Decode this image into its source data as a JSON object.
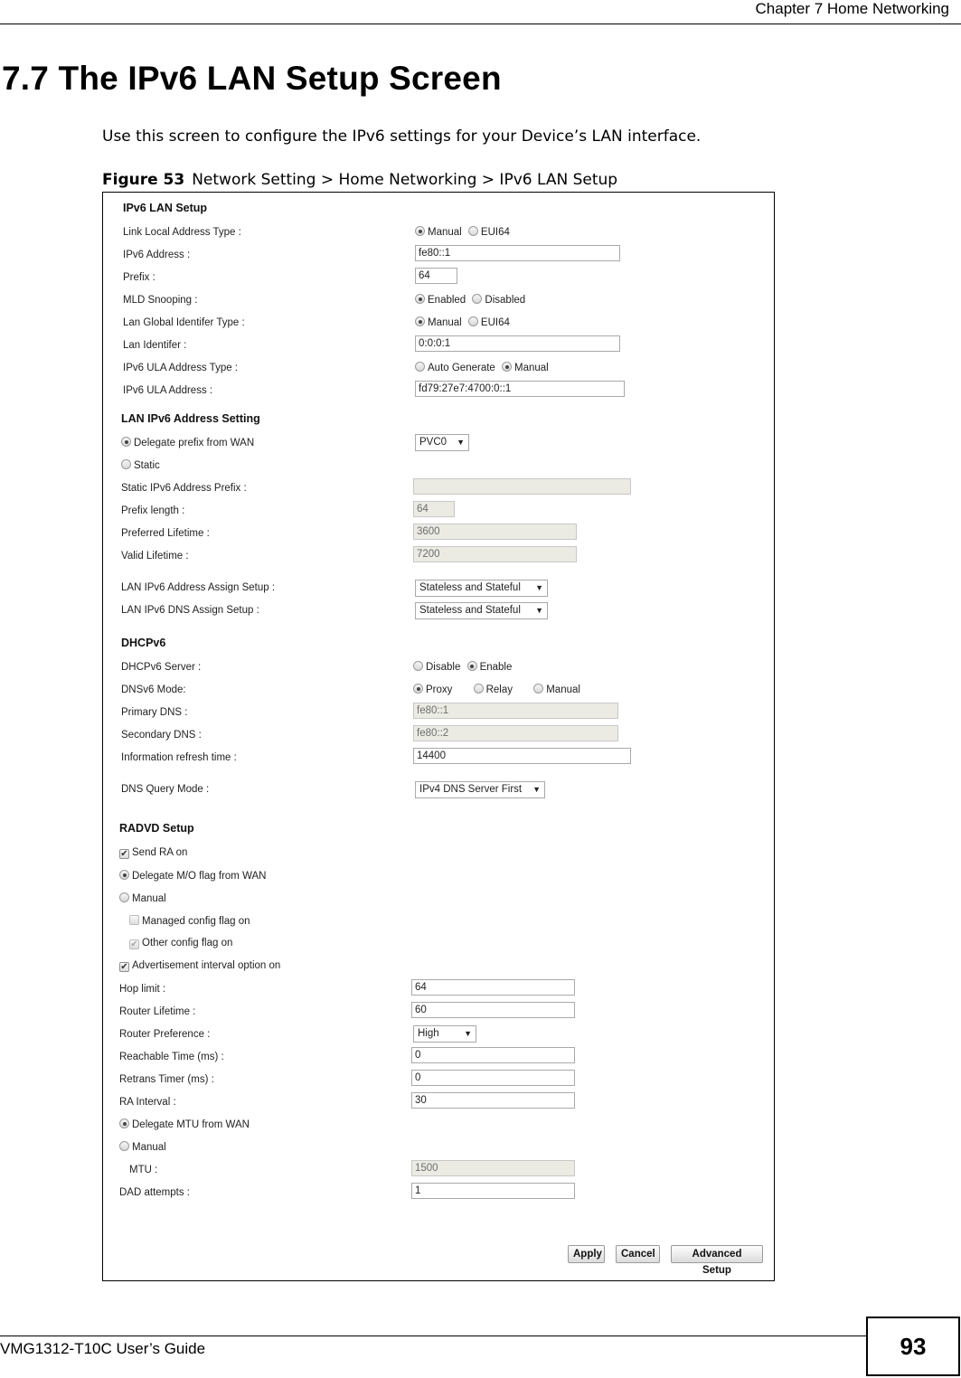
{
  "header": {
    "chapter": "Chapter 7 Home Networking"
  },
  "section": {
    "title": "7.7  The IPv6 LAN Setup Screen",
    "intro": "Use this screen to configure the IPv6 settings for your Device’s LAN interface.",
    "figure_label": "Figure 53",
    "figure_caption": "Network Setting > Home Networking > IPv6 LAN Setup"
  },
  "ipv6_lan_setup": {
    "heading": "IPv6 LAN Setup",
    "link_local_type": {
      "label": "Link Local Address Type :",
      "options": [
        "Manual",
        "EUI64"
      ],
      "selected": "Manual"
    },
    "ipv6_address": {
      "label": "IPv6 Address :",
      "value": "fe80::1"
    },
    "prefix": {
      "label": "Prefix :",
      "value": "64"
    },
    "mld_snooping": {
      "label": "MLD Snooping :",
      "options": [
        "Enabled",
        "Disabled"
      ],
      "selected": "Enabled"
    },
    "lan_global_id_type": {
      "label": "Lan Global Identifer Type :",
      "options": [
        "Manual",
        "EUI64"
      ],
      "selected": "Manual"
    },
    "lan_identifier": {
      "label": "Lan Identifer :",
      "value": "0:0:0:1"
    },
    "ula_type": {
      "label": "IPv6 ULA Address Type :",
      "options": [
        "Auto Generate",
        "Manual"
      ],
      "selected": "Manual"
    },
    "ula_address": {
      "label": "IPv6 ULA Address :",
      "value": "fd79:27e7:4700:0::1"
    }
  },
  "lan_address_setting": {
    "heading": "LAN IPv6 Address Setting",
    "delegate": {
      "label": "Delegate prefix from WAN",
      "selected": true,
      "wan": "PVC0"
    },
    "static": {
      "label": "Static",
      "selected": false
    },
    "static_prefix": {
      "label": "Static IPv6 Address Prefix :",
      "value": ""
    },
    "prefix_length": {
      "label": "Prefix length :",
      "value": "64"
    },
    "preferred_lifetime": {
      "label": "Preferred Lifetime :",
      "value": "3600"
    },
    "valid_lifetime": {
      "label": "Valid Lifetime :",
      "value": "7200"
    },
    "address_assign": {
      "label": "LAN IPv6 Address Assign Setup :",
      "value": "Stateless and Stateful"
    },
    "dns_assign": {
      "label": "LAN IPv6 DNS Assign Setup :",
      "value": "Stateless and Stateful"
    }
  },
  "dhcpv6": {
    "heading": "DHCPv6",
    "server": {
      "label": "DHCPv6 Server :",
      "options": [
        "Disable",
        "Enable"
      ],
      "selected": "Enable"
    },
    "dns_mode": {
      "label": "DNSv6 Mode:",
      "options": [
        "Proxy",
        "Relay",
        "Manual"
      ],
      "selected": "Proxy"
    },
    "primary_dns": {
      "label": "Primary DNS :",
      "value": "fe80::1"
    },
    "secondary_dns": {
      "label": "Secondary DNS :",
      "value": "fe80::2"
    },
    "refresh_time": {
      "label": "Information refresh time :",
      "value": "14400"
    },
    "dns_query_mode": {
      "label": "DNS Query Mode :",
      "value": "IPv4 DNS Server First"
    }
  },
  "radvd": {
    "heading": "RADVD Setup",
    "send_ra": {
      "label": "Send RA on",
      "checked": true
    },
    "delegate_mo": {
      "label": "Delegate M/O flag from WAN",
      "selected": true
    },
    "manual_mo": {
      "label": "Manual",
      "selected": false
    },
    "managed_flag": {
      "label": "Managed config flag on",
      "checked": false
    },
    "other_flag": {
      "label": "Other config flag on",
      "checked": true
    },
    "adv_interval": {
      "label": "Advertisement interval option on",
      "checked": true
    },
    "hop_limit": {
      "label": "Hop limit :",
      "value": "64"
    },
    "router_lifetime": {
      "label": "Router Lifetime :",
      "value": "60"
    },
    "router_preference": {
      "label": "Router Preference :",
      "value": "High"
    },
    "reachable_time": {
      "label": "Reachable Time (ms) :",
      "value": "0"
    },
    "retrans_timer": {
      "label": "Retrans Timer (ms) :",
      "value": "0"
    },
    "ra_interval": {
      "label": "RA Interval :",
      "value": "30"
    },
    "delegate_mtu": {
      "label": "Delegate MTU from WAN",
      "selected": true
    },
    "manual_mtu": {
      "label": "Manual",
      "selected": false
    },
    "mtu": {
      "label": "MTU :",
      "value": "1500"
    },
    "dad_attempts": {
      "label": "DAD attempts :",
      "value": "1"
    }
  },
  "buttons": {
    "apply": "Apply",
    "cancel": "Cancel",
    "advanced": "Advanced Setup"
  },
  "footer": {
    "guide": "VMG1312-T10C User’s Guide",
    "page": "93"
  }
}
